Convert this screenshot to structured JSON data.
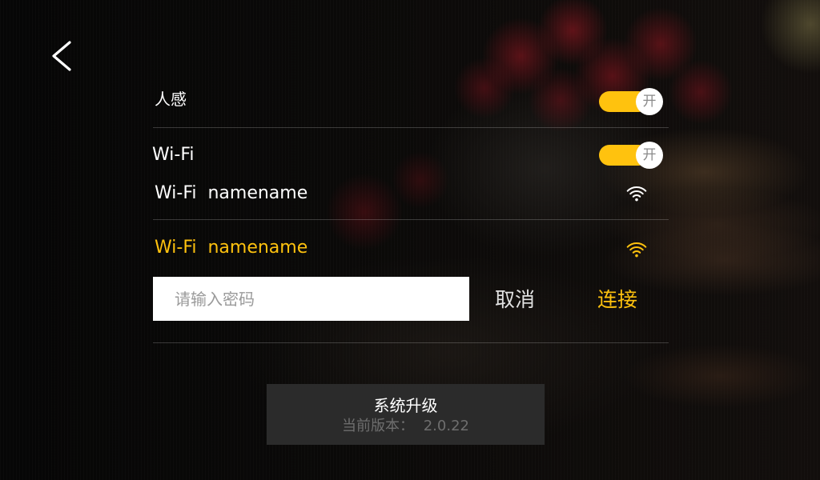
{
  "nav": {
    "back_icon": "chevron-left-icon"
  },
  "settings": {
    "motion_sensor": {
      "label": "人感",
      "toggle_text": "开",
      "on": true
    },
    "wifi": {
      "label": "Wi-Fi",
      "toggle_text": "开",
      "on": true
    },
    "networks": [
      {
        "name": "Wi-Fi  namename",
        "icon": "wifi-icon",
        "selected": false
      },
      {
        "name": "Wi-Fi  namename",
        "icon": "wifi-icon",
        "selected": true
      }
    ],
    "password": {
      "placeholder": "请输入密码",
      "value": ""
    },
    "cancel_label": "取消",
    "connect_label": "连接"
  },
  "upgrade": {
    "title": "系统升级",
    "version_label": "当前版本：",
    "version": "2.0.22"
  },
  "colors": {
    "accent": "#FFC20E",
    "text": "#FFFFFF",
    "button_bg": "#2B2B2B"
  }
}
